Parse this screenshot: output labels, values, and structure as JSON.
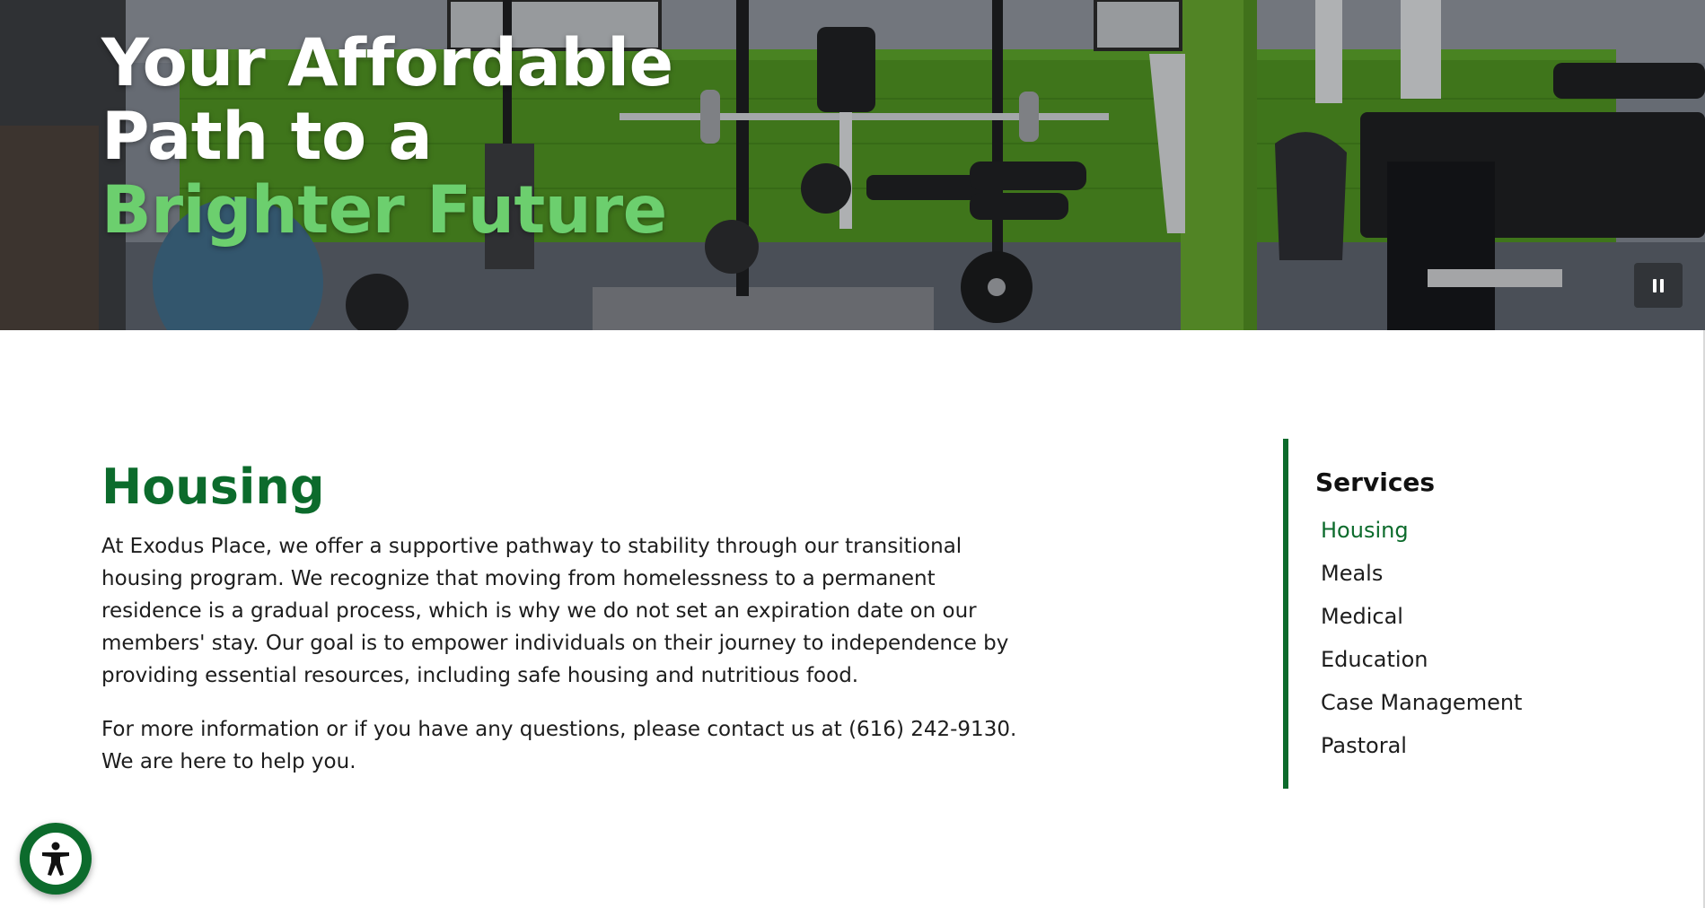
{
  "hero": {
    "title_line1": "Your Affordable",
    "title_line2": "Path to a",
    "title_accent": "Brighter Future",
    "background_description_icon": "gym-photo",
    "pause_icon": "pause-icon"
  },
  "main": {
    "heading": "Housing",
    "paragraph1": "At Exodus Place, we offer a supportive pathway to stability through our transitional housing program. We recognize that moving from homelessness to a permanent residence is a gradual process, which is why we do not set an expiration date on our members' stay. Our goal is to empower individuals on their journey to independence by providing essential resources, including safe housing and nutritious food.",
    "paragraph2": "For more information or if you have any questions, please contact us at (616) 242-9130. We are here to help you."
  },
  "sidebar": {
    "title": "Services",
    "items": [
      {
        "label": "Housing",
        "active": true
      },
      {
        "label": "Meals",
        "active": false
      },
      {
        "label": "Medical",
        "active": false
      },
      {
        "label": "Education",
        "active": false
      },
      {
        "label": "Case Management",
        "active": false
      },
      {
        "label": "Pastoral",
        "active": false
      }
    ]
  },
  "accessibility": {
    "icon": "accessibility-icon"
  },
  "colors": {
    "brand_green": "#0c6b2c",
    "accent_green": "#6ccf6e",
    "text": "#1d1d1d"
  }
}
